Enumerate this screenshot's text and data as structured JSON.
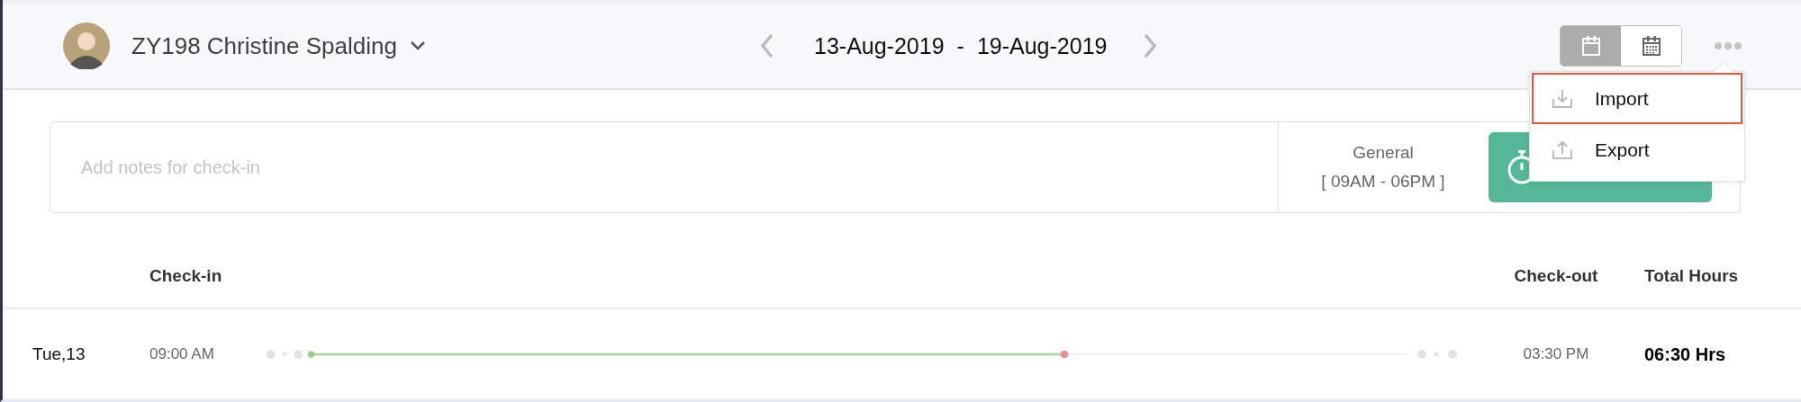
{
  "header": {
    "employee": "ZY198 Christine Spalding",
    "date_range": {
      "start": "13-Aug-2019",
      "separator": "-",
      "end": "19-Aug-2019"
    },
    "view_toggle": [
      {
        "kind": "day",
        "selected": true
      },
      {
        "kind": "month",
        "selected": false
      }
    ],
    "more_menu": {
      "expanded": true,
      "items": [
        {
          "label": "Import",
          "kind": "import",
          "selected": true
        },
        {
          "label": "Export",
          "kind": "export",
          "selected": false
        }
      ]
    }
  },
  "checkin_panel": {
    "notes_placeholder": "Add notes for check-in",
    "shift": {
      "name": "General",
      "hours": "[ 09AM - 06PM ]"
    }
  },
  "table": {
    "columns": [
      "Check-in",
      "Check-out",
      "Total Hours"
    ],
    "rows": [
      {
        "day": "Tue,13",
        "check_in": "09:00 AM",
        "check_out": "03:30 PM",
        "total_hours": "06:30 Hrs"
      }
    ]
  }
}
